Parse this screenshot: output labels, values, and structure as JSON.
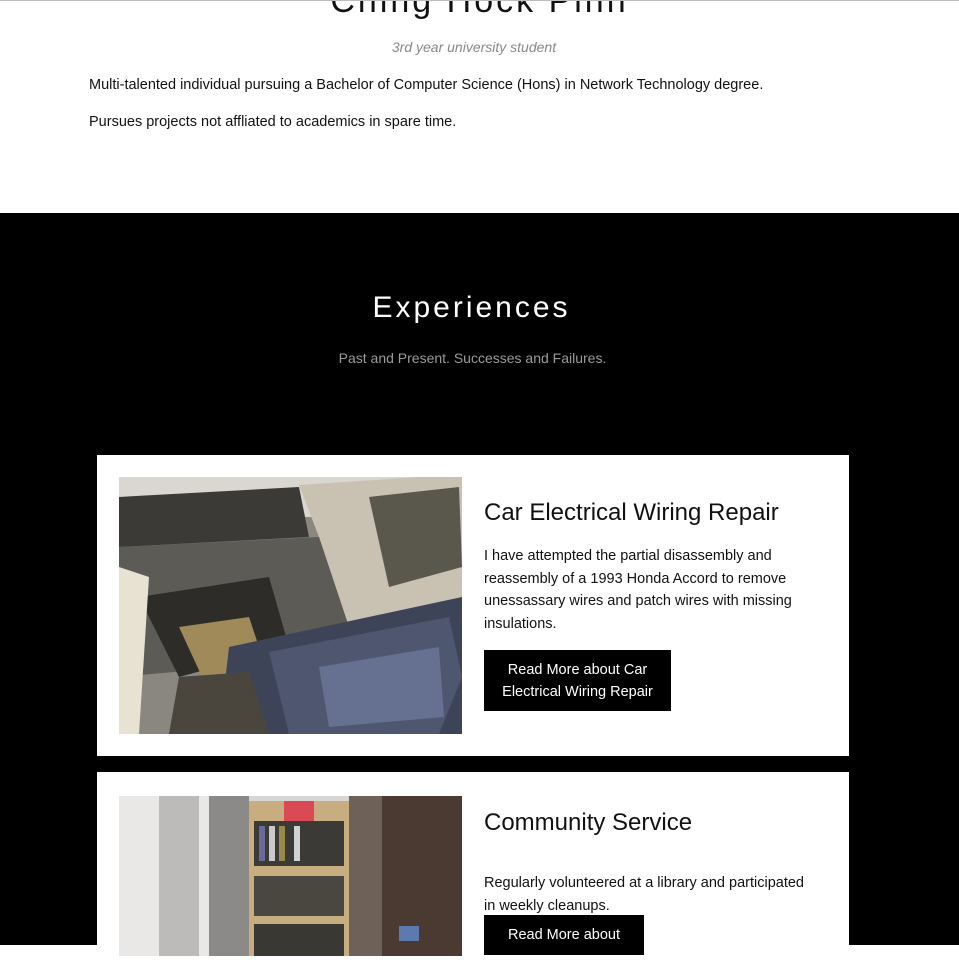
{
  "about": {
    "name": "Ching Hock Pinh",
    "subtitle": "3rd year university student",
    "paragraphs": [
      "Multi-talented individual pursuing a Bachelor of Computer Science (Hons) in Network Technology degree.",
      "Pursues projects not affliated to academics in spare time."
    ]
  },
  "experiences": {
    "title": "Experiences",
    "tagline": "Past and Present. Successes and Failures.",
    "items": [
      {
        "title": "Car Electrical Wiring Repair",
        "description": "I have attempted the partial disassembly and reassembly of a 1993 Honda Accord to remove unessassary wires and patch wires with missing insulations.",
        "button_label": "Read More about Car Electrical Wiring Repair",
        "image": "car-interior-photo"
      },
      {
        "title": "Community Service",
        "description": "Regularly volunteered at a library and participated in weekly cleanups.",
        "button_label": "Read More about",
        "image": "library-bookshelf-photo"
      }
    ]
  }
}
